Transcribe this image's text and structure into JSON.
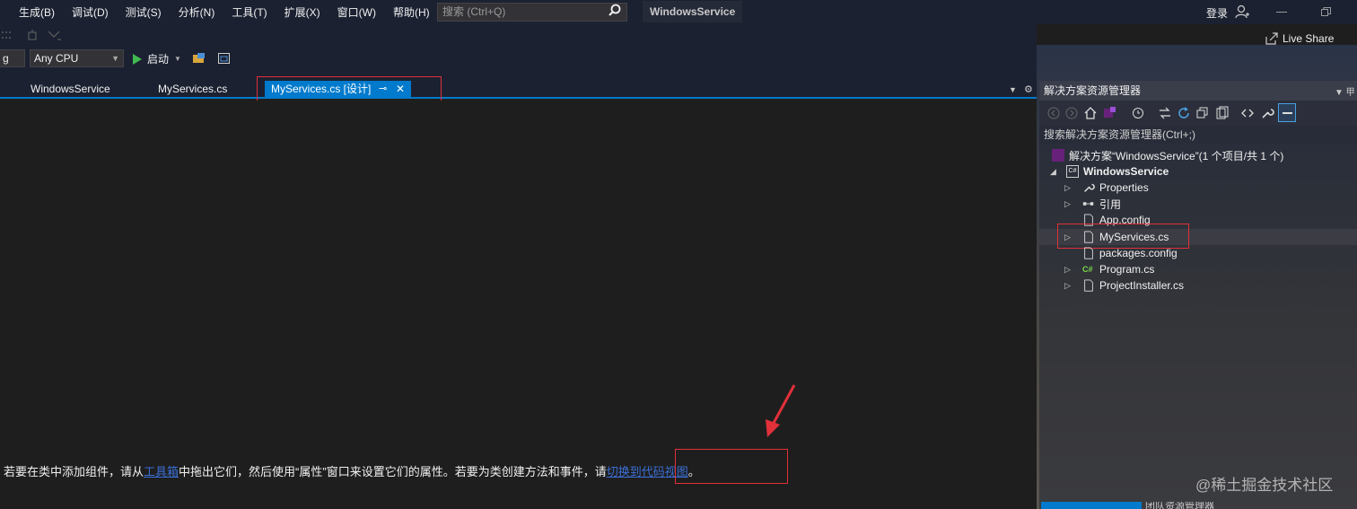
{
  "menu": {
    "items": [
      "生成(B)",
      "调试(D)",
      "测试(S)",
      "分析(N)",
      "工具(T)",
      "扩展(X)",
      "窗口(W)",
      "帮助(H)"
    ],
    "search_placeholder": "搜索 (Ctrl+Q)",
    "app_title": "WindowsService",
    "signin_label": "登录"
  },
  "toolbar": {
    "config_value": "g",
    "platform_value": "Any CPU",
    "start_label": "启动",
    "liveshare_label": "Live Share"
  },
  "tabs": {
    "items": [
      "WindowsService",
      "MyServices.cs"
    ],
    "active_label": "MyServices.cs [设计]"
  },
  "designer": {
    "msg_part1": "若要在类中添加组件，请从",
    "link1": "工具箱",
    "msg_part2": "中拖出它们，然后使用“属性”窗口来设置它们的属性。若要为类创建方法和事件，请",
    "link2": "切换到代码视图",
    "msg_part3": "。"
  },
  "solution_explorer": {
    "title": "解决方案资源管理器",
    "search_placeholder": "搜索解决方案资源管理器(Ctrl+;)",
    "solution_label": "解决方案“WindowsService”(1 个项目/共 1 个)",
    "project_label": "WindowsService",
    "items": [
      "Properties",
      "引用",
      "App.config",
      "MyServices.cs",
      "packages.config",
      "Program.cs",
      "ProjectInstaller.cs"
    ],
    "bottom_tab2": "团队资源管理器"
  },
  "watermark": "@稀土掘金技术社区",
  "colors": {
    "accent": "#007acc",
    "annotation": "#e0303a",
    "link": "#3b6fd6"
  }
}
